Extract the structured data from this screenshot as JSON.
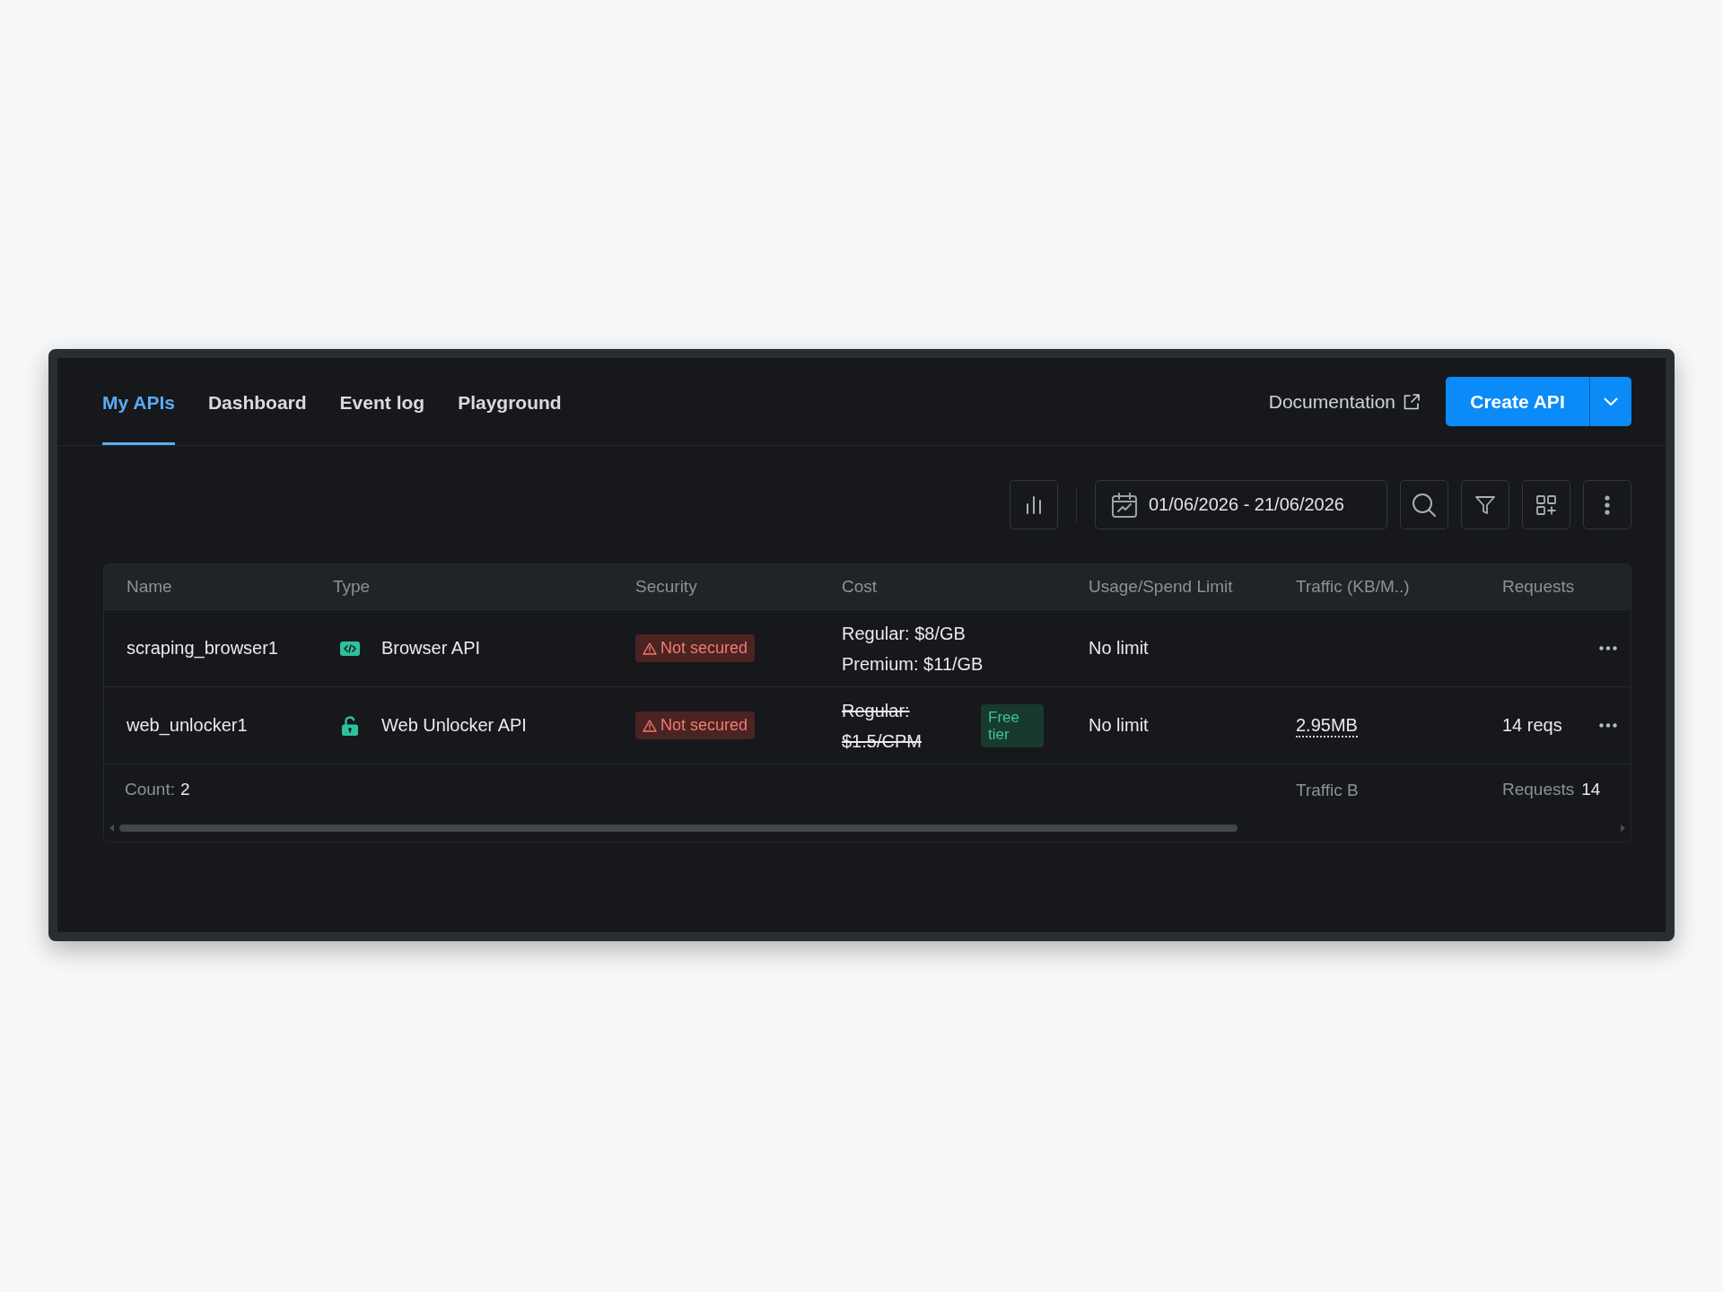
{
  "tabs": [
    {
      "label": "My APIs",
      "selected": true
    },
    {
      "label": "Dashboard",
      "selected": false
    },
    {
      "label": "Event log",
      "selected": false
    },
    {
      "label": "Playground",
      "selected": false
    }
  ],
  "header_actions": {
    "documentation_link": "Documentation",
    "create_button": "Create API"
  },
  "toolbar": {
    "date_range": "01/06/2026 - 21/06/2026"
  },
  "table": {
    "columns": [
      "Name",
      "Type",
      "Security",
      "Cost",
      "Usage/Spend Limit",
      "Traffic (KB/M..)",
      "Requests"
    ],
    "rows": [
      {
        "kind": "browser",
        "name": "scraping_browser1",
        "type": "Browser API",
        "security": {
          "label": "Not secured",
          "secured": false
        },
        "cost": [
          {
            "text": "Regular: $8/GB",
            "struck": false
          },
          {
            "text": "Premium: $11/GB",
            "struck": false
          }
        ],
        "limit": "No limit"
      },
      {
        "kind": "unlocker",
        "name": "web_unlocker1",
        "type": "Web Unlocker API",
        "security": {
          "label": "Not secured",
          "secured": false
        },
        "cost": [
          {
            "text": "Regular: $1.5/CPM",
            "struck": true
          }
        ],
        "cost_badge": "Free tier",
        "limit": "No limit",
        "traffic": "2.95MB",
        "requests": "14 reqs"
      }
    ],
    "footer": {
      "count_label": "Count:",
      "count_value": "2",
      "traffic_label": "Traffic B",
      "requests_label": "Requests",
      "requests_value": "14"
    }
  }
}
